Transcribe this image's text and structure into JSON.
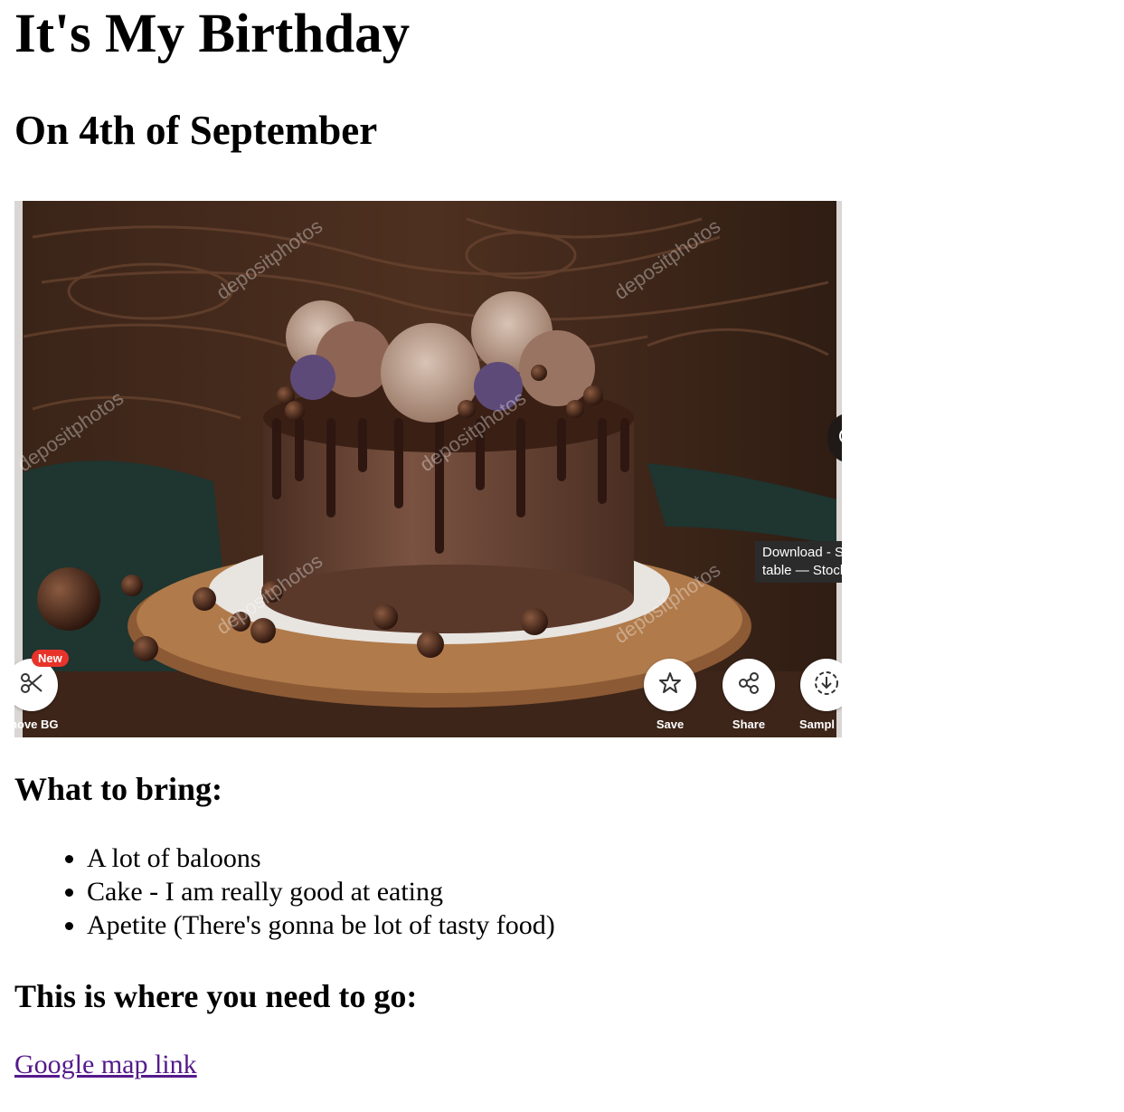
{
  "title": "It's My Birthday",
  "subtitle": "On 4th of September",
  "photo": {
    "watermark": "depositphotos",
    "tooltip_line1": "Download - S",
    "tooltip_line2": "table — Stock",
    "new_badge": "New",
    "buttons": {
      "remove_bg": "move BG",
      "save": "Save",
      "share": "Share",
      "sample": "Sampl"
    },
    "icons": [
      "scissors-icon",
      "star-icon",
      "share-icon",
      "download-icon",
      "zoom-in-icon"
    ]
  },
  "bring_heading": "What to bring:",
  "items": [
    "A lot of baloons",
    "Cake - I am really good at eating",
    "Apetite (There's gonna be lot of tasty food)"
  ],
  "go_heading": "This is where you need to go:",
  "map_link": "Google map link",
  "colors": {
    "link_visited": "#551a8b",
    "badge_red": "#e8332a"
  }
}
